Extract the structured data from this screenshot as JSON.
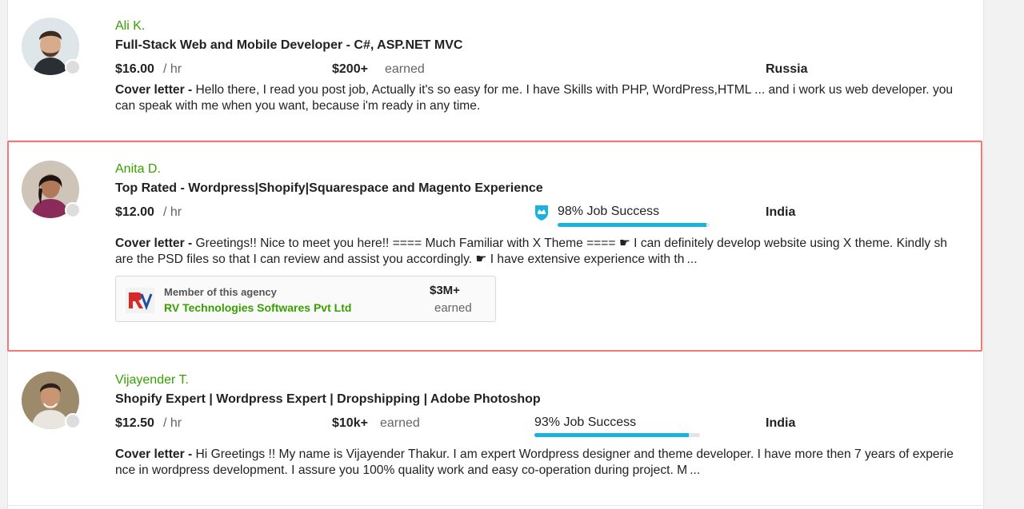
{
  "freelancers": [
    {
      "name": "Ali K.",
      "title": "Full-Stack Web and Mobile Developer - C#, ASP.NET MVC",
      "rate": "$16.00",
      "rate_unit": "/ hr",
      "earned_amount": "$200+",
      "earned_label": "earned",
      "country": "Russia",
      "cover_label": "Cover letter -",
      "cover_text": "Hello there, I read you post job, Actually it's so easy for me. I have Skills with PHP, WordPress,HTML ... and i work us web developer. you can speak with me when you want, because i'm ready in any time."
    },
    {
      "name": "Anita D.",
      "title": "Top Rated - Wordpress|Shopify|Squarespace and Magento Experience",
      "rate": "$12.00",
      "rate_unit": "/ hr",
      "job_success": "98% Job Success",
      "job_success_value": 0.98,
      "top_rated_badge": "top-rated-badge-icon",
      "country": "India",
      "cover_label": "Cover letter -",
      "cover_text": "Greetings!! Nice to meet you here!! ==== Much Familiar with X Theme ==== ☛ I can definitely develop website using X theme. Kindly share the PSD files so that I can review and assist you accordingly. ☛ I have extensive experience with th ...",
      "agency": {
        "caption": "Member of this agency",
        "name": "RV Technologies Softwares Pvt Ltd",
        "earned_amount": "$3M+",
        "earned_label": "earned"
      }
    },
    {
      "name": "Vijayender T.",
      "title": "Shopify Expert | Wordpress Expert | Dropshipping | Adobe Photoshop",
      "rate": "$12.50",
      "rate_unit": "/ hr",
      "earned_amount": "$10k+",
      "earned_label": "earned",
      "job_success": "93% Job Success",
      "job_success_value": 0.93,
      "country": "India",
      "cover_label": "Cover letter -",
      "cover_text": "Hi Greetings !! My name is Vijayender Thakur. I am expert Wordpress designer and theme developer. I have more then 7 years of experience in wordpress development. I assure you 100% quality work and easy co-operation during project. M ..."
    }
  ],
  "colors": {
    "name_green": "#37a000",
    "progress_blue": "#1bb3dd",
    "selected_border": "#f07878"
  }
}
